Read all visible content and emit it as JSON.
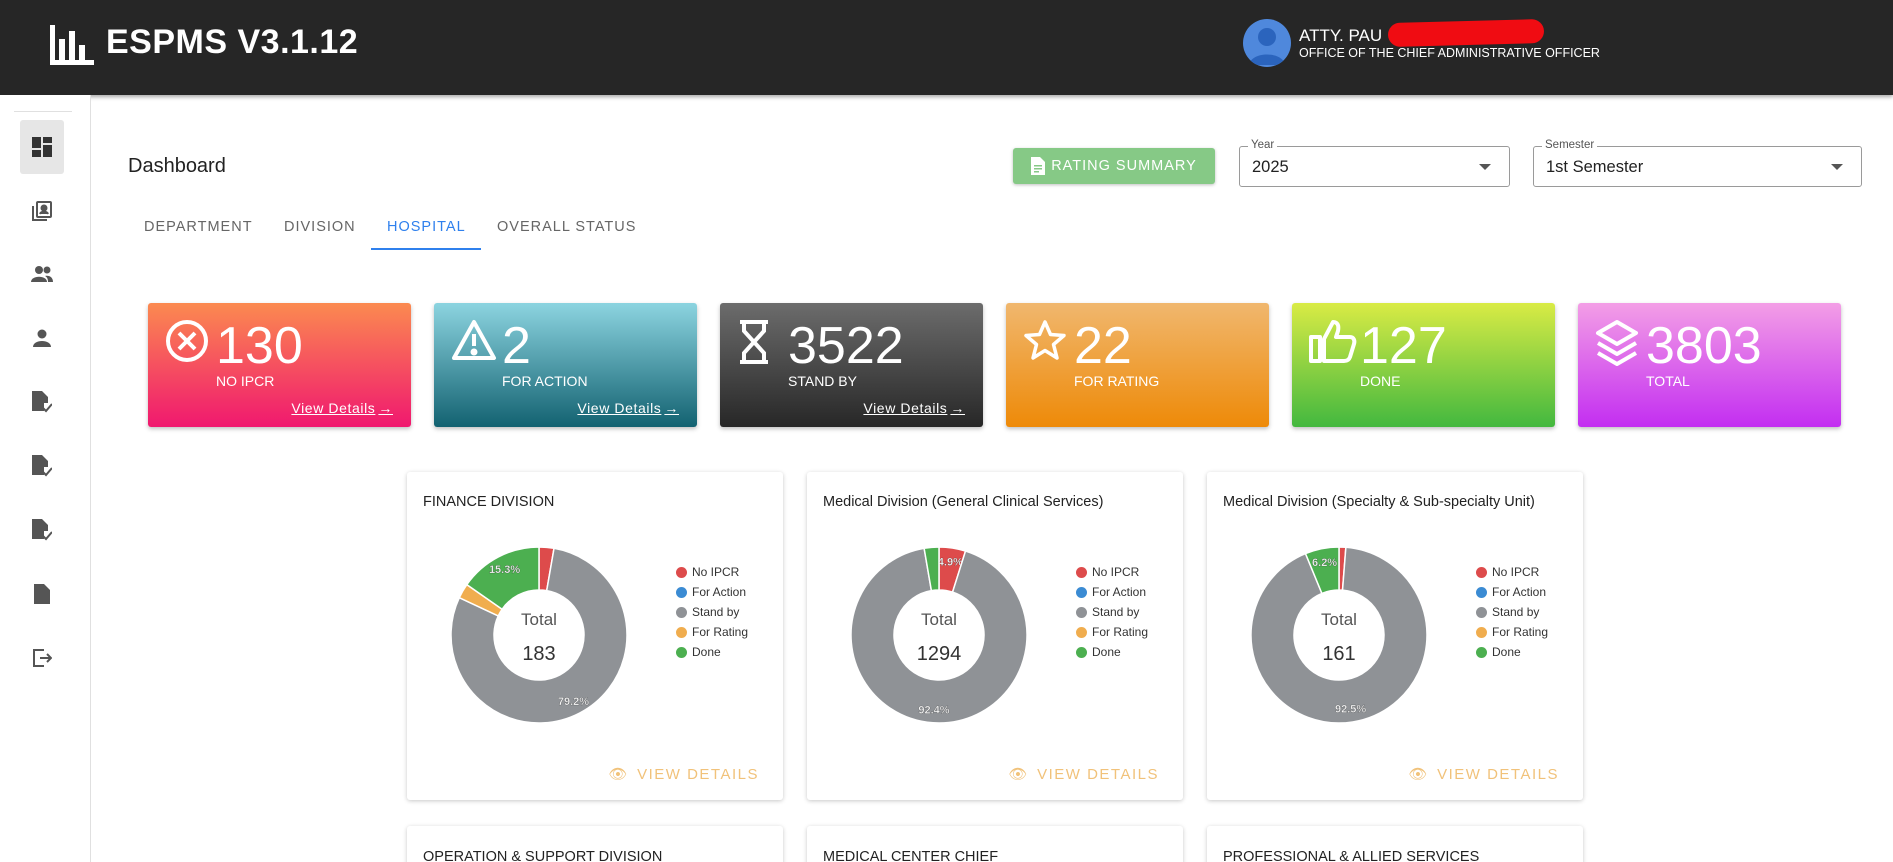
{
  "app": {
    "title": "ESPMS V3.1.12"
  },
  "user": {
    "name": "ATTY. PAU",
    "office": "OFFICE OF THE CHIEF ADMINISTRATIVE OFFICER"
  },
  "sidebar": {
    "items": [
      {
        "icon": "dashboard-icon",
        "active": true
      },
      {
        "icon": "contact-book-icon"
      },
      {
        "icon": "group-icon"
      },
      {
        "icon": "person-icon"
      },
      {
        "icon": "file-check-icon"
      },
      {
        "icon": "file-check-icon"
      },
      {
        "icon": "file-check-icon"
      },
      {
        "icon": "file-icon"
      },
      {
        "icon": "logout-icon"
      }
    ]
  },
  "page": {
    "title": "Dashboard"
  },
  "rating_summary": {
    "label": "RATING SUMMARY"
  },
  "year": {
    "label": "Year",
    "value": "2025"
  },
  "semester": {
    "label": "Semester",
    "value": "1st Semester"
  },
  "tabs": [
    {
      "label": "DEPARTMENT"
    },
    {
      "label": "DIVISION"
    },
    {
      "label": "HOSPITAL",
      "active": true
    },
    {
      "label": "OVERALL STATUS"
    }
  ],
  "stats": [
    {
      "value": "130",
      "label": "NO IPCR",
      "link": "View Details",
      "icon": "cancel-circle-icon",
      "colors": [
        "#fb8a50",
        "#f0186f"
      ]
    },
    {
      "value": "2",
      "label": "FOR ACTION",
      "link": "View Details",
      "icon": "warning-icon",
      "colors": [
        "#8cd4e0",
        "#136271"
      ]
    },
    {
      "value": "3522",
      "label": "STAND BY",
      "link": "View Details",
      "icon": "hourglass-icon",
      "colors": [
        "#6c6c6c",
        "#272727"
      ]
    },
    {
      "value": "22",
      "label": "FOR RATING",
      "icon": "star-icon",
      "colors": [
        "#f0b76e",
        "#ee8a08"
      ]
    },
    {
      "value": "127",
      "label": "DONE",
      "icon": "thumbs-up-icon",
      "colors": [
        "#d9eb45",
        "#43b83f"
      ]
    },
    {
      "value": "3803",
      "label": "TOTAL",
      "icon": "layers-icon",
      "colors": [
        "#f39ee6",
        "#c32ef1"
      ]
    }
  ],
  "legend": [
    {
      "label": "No IPCR",
      "color": "#dd4b4b"
    },
    {
      "label": "For Action",
      "color": "#3b8bd3"
    },
    {
      "label": "Stand by",
      "color": "#8f9296"
    },
    {
      "label": "For Rating",
      "color": "#f0ad4e"
    },
    {
      "label": "Done",
      "color": "#4caf50"
    }
  ],
  "card_link": "VIEW DETAILS",
  "total_label": "Total",
  "chart_data": [
    {
      "type": "pie",
      "title": "FINANCE DIVISION",
      "total": "183",
      "categories": [
        "No IPCR",
        "For Action",
        "Stand by",
        "For Rating",
        "Done"
      ],
      "values": [
        5,
        0,
        145,
        5,
        28
      ],
      "data_labels": [
        "",
        "",
        "79.2%",
        "",
        "15.3%"
      ]
    },
    {
      "type": "pie",
      "title": "Medical Division (General Clinical Services)",
      "total": "1294",
      "categories": [
        "No IPCR",
        "For Action",
        "Stand by",
        "For Rating",
        "Done"
      ],
      "values": [
        63,
        0,
        1196,
        0,
        35
      ],
      "data_labels": [
        "4.9%",
        "",
        "92.4%",
        "",
        ""
      ]
    },
    {
      "type": "pie",
      "title": "Medical Division (Specialty & Sub-specialty Unit)",
      "total": "161",
      "categories": [
        "No IPCR",
        "For Action",
        "Stand by",
        "For Rating",
        "Done"
      ],
      "values": [
        2,
        0,
        149,
        0,
        10
      ],
      "data_labels": [
        "",
        "",
        "92.5%",
        "",
        "6.2%"
      ]
    }
  ],
  "lower_cards": [
    {
      "title": "OPERATION & SUPPORT DIVISION"
    },
    {
      "title": "MEDICAL CENTER CHIEF"
    },
    {
      "title": "PROFESSIONAL & ALLIED SERVICES"
    }
  ]
}
